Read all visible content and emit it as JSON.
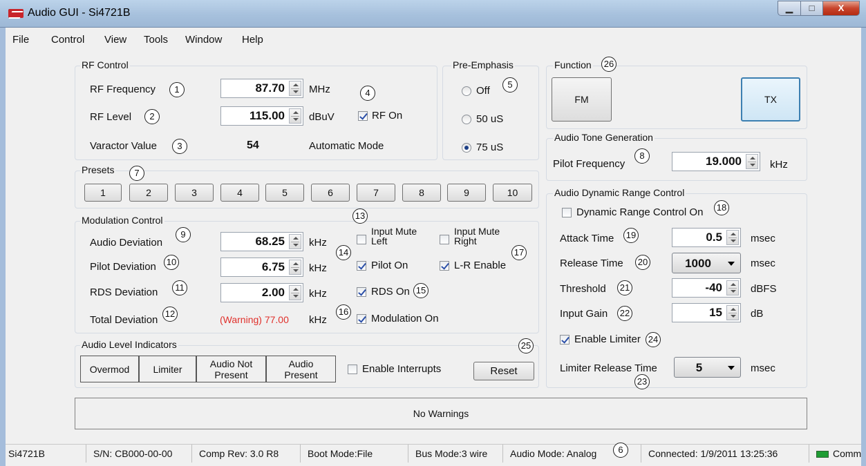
{
  "window": {
    "title": "Audio GUI - Si4721B",
    "min_glyph": "▁",
    "max_glyph": "□",
    "close_glyph": "X"
  },
  "menu": [
    "File",
    "Control",
    "View",
    "Tools",
    "Window",
    "Help"
  ],
  "rf": {
    "title": "RF Control",
    "freq_label": "RF Frequency",
    "freq_value": "87.70",
    "freq_unit": "MHz",
    "level_label": "RF Level",
    "level_value": "115.00",
    "level_unit": "dBuV",
    "rf_on_label": "RF On",
    "rf_on": true,
    "varactor_label": "Varactor Value",
    "varactor_value": "54",
    "mode_text": "Automatic Mode"
  },
  "preemph": {
    "title": "Pre-Emphasis",
    "options": [
      "Off",
      "50 uS",
      "75 uS"
    ],
    "selected": "75 uS"
  },
  "function": {
    "title": "Function",
    "fm_label": "FM",
    "tx_label": "TX"
  },
  "tone": {
    "title": "Audio Tone Generation",
    "pilot_label": "Pilot Frequency",
    "pilot_value": "19.000",
    "pilot_unit": "kHz"
  },
  "presets": {
    "title": "Presets",
    "buttons": [
      "1",
      "2",
      "3",
      "4",
      "5",
      "6",
      "7",
      "8",
      "9",
      "10"
    ]
  },
  "mod": {
    "title": "Modulation Control",
    "audio_label": "Audio Deviation",
    "audio_value": "68.25",
    "pilot_label": "Pilot Deviation",
    "pilot_value": "6.75",
    "rds_label": "RDS Deviation",
    "rds_value": "2.00",
    "total_label": "Total Deviation",
    "total_value": "(Warning) 77.00",
    "unit": "kHz",
    "mute_left_label": "Input Mute\nLeft",
    "mute_right_label": "Input Mute\nRight",
    "pilot_on_label": "Pilot On",
    "lr_label": "L-R Enable",
    "rds_on_label": "RDS On",
    "modulation_on_label": "Modulation On"
  },
  "levels": {
    "title": "Audio Level Indicators",
    "overmod": "Overmod",
    "limiter": "Limiter",
    "not_present": "Audio Not\nPresent",
    "present": "Audio\nPresent",
    "interrupts_label": "Enable Interrupts",
    "reset_label": "Reset"
  },
  "drc": {
    "title": "Audio Dynamic Range Control",
    "drc_on_label": "Dynamic Range Control On",
    "attack_label": "Attack Time",
    "attack_value": "0.5",
    "attack_unit": "msec",
    "release_label": "Release Time",
    "release_value": "1000",
    "release_unit": "msec",
    "threshold_label": "Threshold",
    "threshold_value": "-40",
    "threshold_unit": "dBFS",
    "gain_label": "Input Gain",
    "gain_value": "15",
    "gain_unit": "dB",
    "limiter_label": "Enable Limiter",
    "limiter_release_label": "Limiter Release Time",
    "limiter_release_value": "5",
    "limiter_release_unit": "msec"
  },
  "warning": {
    "text": "No Warnings"
  },
  "status": {
    "device": "Si4721B",
    "serial": "S/N: CB000-00-00",
    "comp_rev": "Comp Rev: 3.0 R8",
    "boot": "Boot Mode:File",
    "bus": "Bus Mode:3 wire",
    "audio_mode": "Audio Mode: Analog",
    "connected": "Connected: 1/9/2011 13:25:36",
    "comm": "Comm"
  },
  "callouts": {
    "n1": "1",
    "n2": "2",
    "n3": "3",
    "n4": "4",
    "n5": "5",
    "n6": "6",
    "n7": "7",
    "n8": "8",
    "n9": "9",
    "n10": "10",
    "n11": "11",
    "n12": "12",
    "n13": "13",
    "n14": "14",
    "n15": "15",
    "n16": "16",
    "n17": "17",
    "n18": "18",
    "n19": "19",
    "n20": "20",
    "n21": "21",
    "n22": "22",
    "n23": "23",
    "n24": "24",
    "n25": "25",
    "n26": "26"
  },
  "colors": {
    "warning_text": "#e0302b",
    "comm_led": "#1f9d34"
  }
}
